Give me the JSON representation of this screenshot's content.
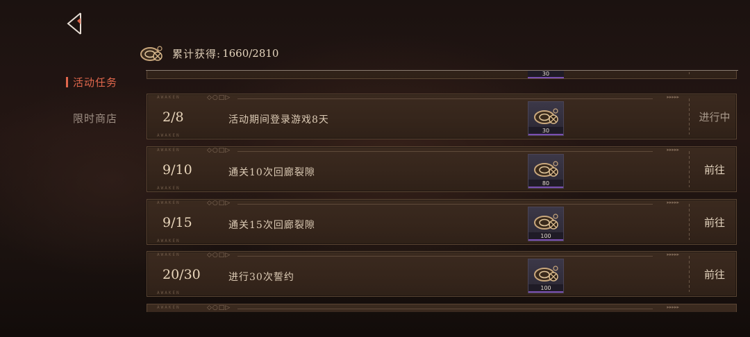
{
  "header": {
    "currency_icon": "compass-coin-icon",
    "label": "累计获得:",
    "current": "1660",
    "total": "/2810"
  },
  "sidebar": {
    "items": [
      {
        "label": "活动任务",
        "active": true
      },
      {
        "label": "限时商店",
        "active": false
      }
    ]
  },
  "tasks": {
    "partial_top": {
      "reward_count": "30"
    },
    "rows": [
      {
        "progress": "2/8",
        "description": "活动期间登录游戏8天",
        "reward_icon": "compass-coin-icon",
        "reward_count": "30",
        "action": "进行中"
      },
      {
        "progress": "9/10",
        "description": "通关10次回廊裂隙",
        "reward_icon": "compass-coin-icon",
        "reward_count": "80",
        "action": "前往"
      },
      {
        "progress": "9/15",
        "description": "通关15次回廊裂隙",
        "reward_icon": "compass-coin-icon",
        "reward_count": "100",
        "action": "前往"
      },
      {
        "progress": "20/30",
        "description": "进行30次誓约",
        "reward_icon": "compass-coin-icon",
        "reward_count": "100",
        "action": "前往"
      }
    ]
  },
  "colors": {
    "accent": "#e0674c",
    "reward_bar": "#7a4fb0"
  }
}
